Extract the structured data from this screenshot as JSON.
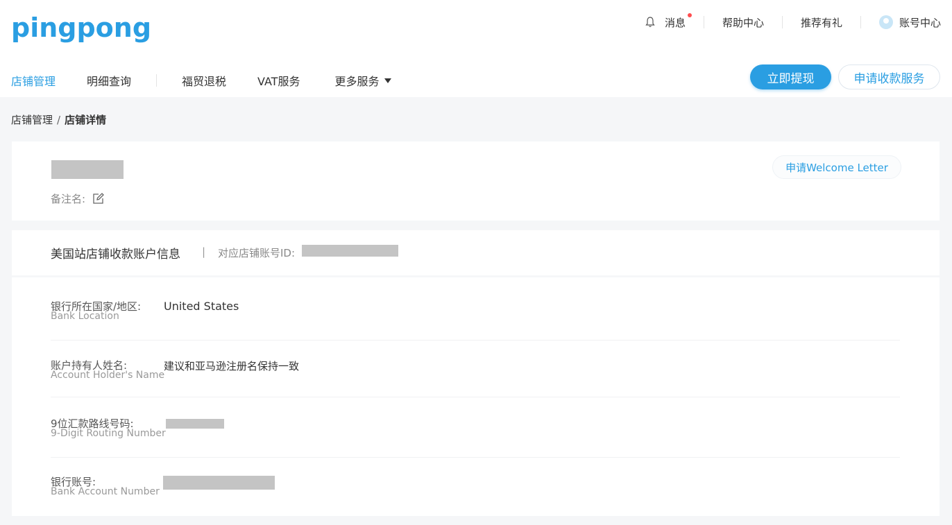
{
  "header": {
    "logo": "pingpong",
    "util_nav": {
      "messages": "消息",
      "help_center": "帮助中心",
      "referral": "推荐有礼",
      "account_center": "账号中心"
    },
    "main_nav": [
      {
        "label": "店铺管理",
        "active": true
      },
      {
        "label": "明细查询",
        "active": false
      },
      {
        "label": "福贸退税",
        "active": false
      },
      {
        "label": "VAT服务",
        "active": false
      },
      {
        "label": "更多服务",
        "active": false
      }
    ],
    "withdraw_button": "立即提现",
    "apply_service_button": "申请收款服务"
  },
  "breadcrumb": {
    "parent": "店铺管理",
    "separator": "/",
    "current": "店铺详情"
  },
  "shop_card": {
    "remark_label": "备注名:",
    "welcome_letter_button": "申请Welcome Letter"
  },
  "account_card": {
    "title": "美国站店铺收款账户信息",
    "divider": "|",
    "shop_id_label": "对应店铺账号ID:",
    "rows": [
      {
        "label_cn": "银行所在国家/地区:",
        "label_en": "Bank Location",
        "value": "United States"
      },
      {
        "label_cn": "账户持有人姓名:",
        "label_en": "Account Holder's Name",
        "value": "建议和亚马逊注册名保持一致"
      },
      {
        "label_cn": "9位汇款路线号码:",
        "label_en": "9-Digit Routing Number",
        "value": ""
      },
      {
        "label_cn": "银行账号:",
        "label_en": "Bank Account Number",
        "value": ""
      }
    ]
  },
  "colors": {
    "brand": "#2a9ee2",
    "background": "#f5f6f8",
    "redacted": "#c4c4c4",
    "notification_dot": "#ff4d4f"
  }
}
